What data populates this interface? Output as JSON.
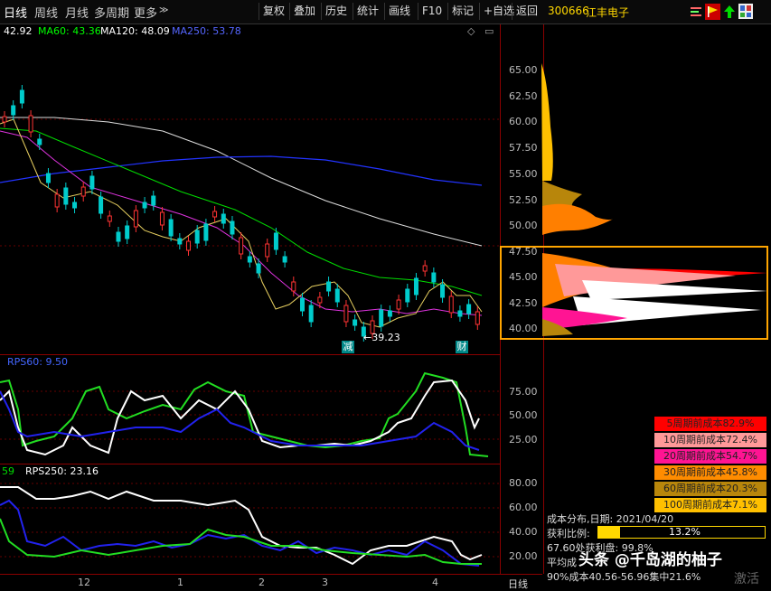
{
  "toolbar": {
    "tabs": [
      "日线",
      "周线",
      "月线",
      "多周期",
      "更多"
    ],
    "buttons": [
      "复权",
      "叠加",
      "历史",
      "统计",
      "画线",
      "F10",
      "标记",
      "+自选",
      "返回"
    ],
    "stock_code": "300666",
    "stock_name": "江丰电子"
  },
  "main": {
    "price": "42.92",
    "ma60": "MA60: 43.36",
    "ma120": "MA120: 48.09",
    "ma250": "MA250: 53.78",
    "low_marker": "←39.23",
    "flag_reduce": "减",
    "flag_finance": "财",
    "y_ticks": [
      "65.00",
      "62.50",
      "60.00",
      "57.50",
      "55.00",
      "52.50",
      "50.00",
      "47.50",
      "45.00",
      "42.50",
      "40.00"
    ]
  },
  "rps60": {
    "label": "RPS60: 9.50",
    "y_ticks": [
      "75.00",
      "50.00",
      "25.00"
    ]
  },
  "rps250": {
    "prefix": "59",
    "label": "RPS250: 23.16",
    "y_ticks": [
      "80.00",
      "60.00",
      "40.00",
      "20.00"
    ]
  },
  "x_axis": {
    "labels": [
      "12",
      "1",
      "2",
      "3",
      "4"
    ],
    "period": "日线"
  },
  "cost_legend": [
    {
      "text": "5周期前成本82.9%",
      "color": "#ff0000"
    },
    {
      "text": "10周期前成本72.4%",
      "color": "#ff9999"
    },
    {
      "text": "20周期前成本54.7%",
      "color": "#ff1493"
    },
    {
      "text": "30周期前成本45.8%",
      "color": "#ff8c00"
    },
    {
      "text": "60周期前成本20.3%",
      "color": "#b8860b"
    },
    {
      "text": "100周期前成本7.1%",
      "color": "#ffc000"
    }
  ],
  "cost_info": {
    "date_line": "成本分布,日期:   2021/04/20",
    "profit_label": "获利比例:",
    "profit_pct": "13.2%",
    "profit_fraction": 0.132,
    "profit_line": "67.60处获利盘: 99.8%",
    "avg_line": "平均成",
    "range90": "90%成本40.56-56.96集中21.6%"
  },
  "watermark": {
    "text": "头条 @千岛湖的柚子",
    "activate": "激活"
  },
  "colors": {
    "ma60": "#00ff00",
    "ma120": "#ffffff",
    "ma250": "#3333ff",
    "accent": "#ffd700",
    "up": "#ff3333",
    "down": "#00cccc"
  }
}
